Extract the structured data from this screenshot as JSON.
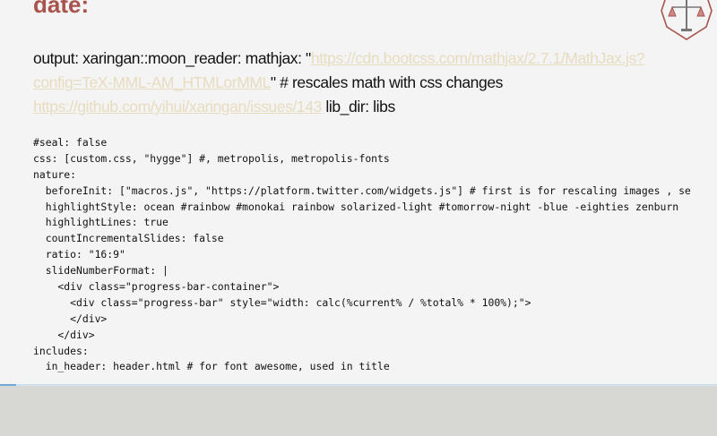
{
  "slide": {
    "heading": "date:",
    "prose": {
      "part1": "output: xaringan::moon_reader: mathjax: \"",
      "link1": "https://cdn.bootcss.com/mathjax/2.7.1/MathJax.js?config=TeX-MML-AM_HTMLorMML",
      "part2": "\" # rescales math with css changes ",
      "link2": "https://github.com/yihui/xaringan/issues/143",
      "part3": " lib_dir: libs"
    },
    "code_lines": [
      "#seal: false",
      "css: [custom.css, \"hygge\"] #, metropolis, metropolis-fonts",
      "nature:",
      "  beforeInit: [\"macros.js\", \"https://platform.twitter.com/widgets.js\"] # first is for rescaling images , se",
      "  highlightStyle: ocean #rainbow #monokai rainbow solarized-light #tomorrow-night -blue -eighties zenburn",
      "  highlightLines: true",
      "  countIncrementalSlides: false",
      "  ratio: \"16:9\"",
      "  slideNumberFormat: |",
      "    <div class=\"progress-bar-container\">",
      "      <div class=\"progress-bar\" style=\"width: calc(%current% / %total% * 100%);\">",
      "      </div>",
      "    </div>",
      "includes:",
      "  in_header: header.html # for font awesome, used in title"
    ],
    "logo_icon": "scales-of-justice-icon"
  },
  "progress": {
    "fraction": 0.023,
    "colors": {
      "fill": "#6ea8d7",
      "track": "#cfe0ee"
    }
  },
  "colors": {
    "heading": "#a8534c",
    "link": "#e7dcc0",
    "slide_bg": "#f4f4f4",
    "page_bg": "#d7d7d3"
  }
}
